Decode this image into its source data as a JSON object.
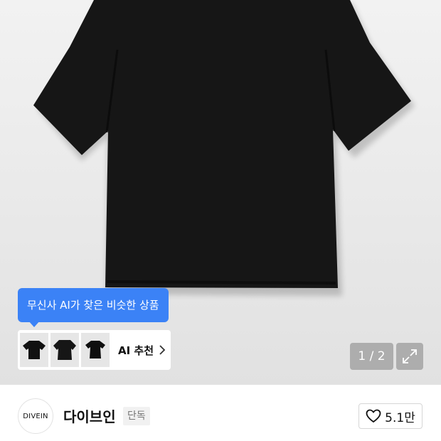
{
  "ai_tooltip": {
    "text": "무신사 AI가 찾은 비슷한 상품"
  },
  "ai_recommend": {
    "label": "AI 추천",
    "thumbnails": [
      "black-tshirt-1",
      "black-tshirt-2",
      "black-tshirt-3"
    ]
  },
  "pager": {
    "text": "1 / 2"
  },
  "brand": {
    "logo_text": "DIVEIN",
    "name": "다이브인",
    "badge": "단독"
  },
  "like": {
    "count": "5.1만"
  },
  "colors": {
    "tooltip_blue": "#3b82f6",
    "product_black": "#111111"
  }
}
